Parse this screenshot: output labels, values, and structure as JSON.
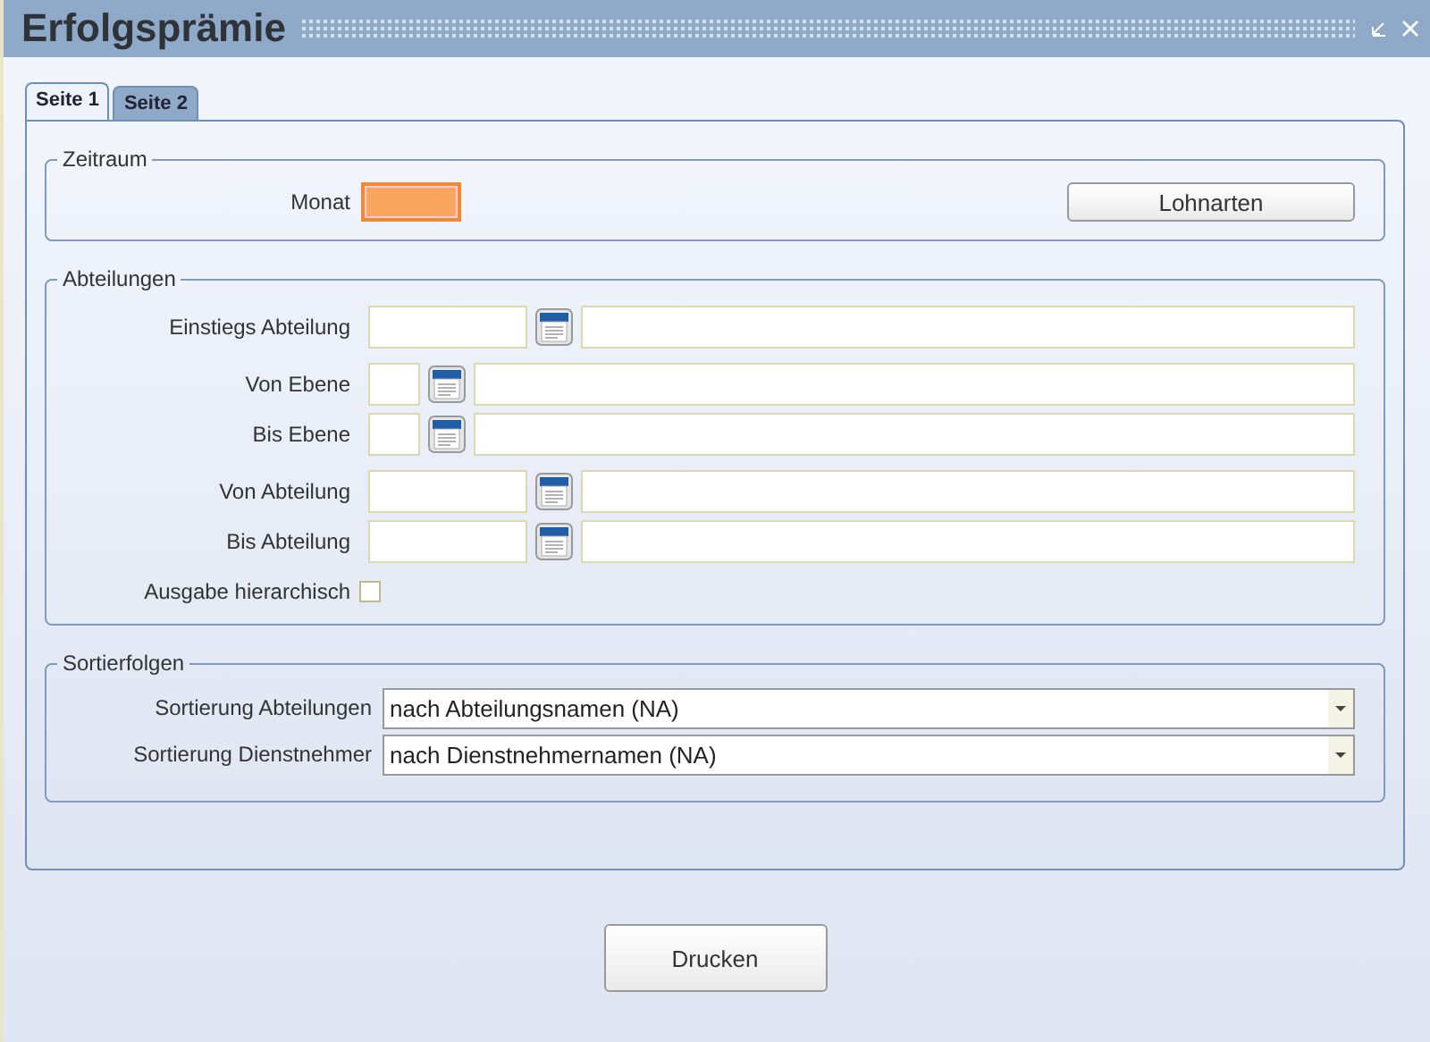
{
  "window": {
    "title": "Erfolgsprämie"
  },
  "tabs": [
    {
      "label": "Seite 1",
      "selected": true
    },
    {
      "label": "Seite 2",
      "selected": false
    }
  ],
  "zeitraum": {
    "legend": "Zeitraum",
    "month_label": "Monat",
    "button": "Lohnarten"
  },
  "abteilungen": {
    "legend": "Abteilungen",
    "groups": [
      [
        {
          "label": "Einstiegs Abteilung",
          "kind": "wide"
        }
      ],
      [
        {
          "label": "Von Ebene",
          "kind": "narrow"
        },
        {
          "label": "Bis Ebene",
          "kind": "narrow"
        }
      ],
      [
        {
          "label": "Von Abteilung",
          "kind": "wide"
        },
        {
          "label": "Bis Abteilung",
          "kind": "wide"
        }
      ]
    ],
    "checkbox": {
      "label": "Ausgabe hierarchisch",
      "checked": false
    }
  },
  "sortierfolgen": {
    "legend": "Sortierfolgen",
    "rows": [
      {
        "label": "Sortierung Abteilungen",
        "value": "nach Abteilungsnamen (NA)"
      },
      {
        "label": "Sortierung Dienstnehmer",
        "value": "nach Dienstnehmernamen (NA)"
      }
    ]
  },
  "footer_button": "Drucken"
}
